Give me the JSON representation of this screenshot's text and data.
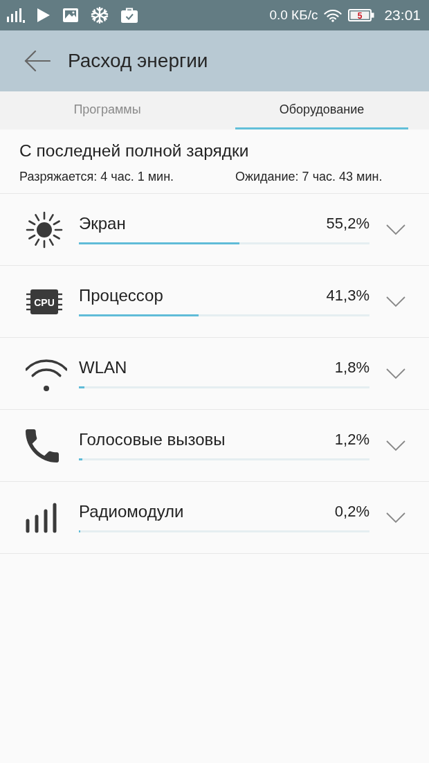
{
  "status_bar": {
    "network_speed": "0.0 КБ/с",
    "battery_text": "5",
    "time": "23:01"
  },
  "header": {
    "title": "Расход энергии"
  },
  "tabs": [
    {
      "label": "Программы",
      "selected": false
    },
    {
      "label": "Оборудование",
      "selected": true
    }
  ],
  "summary": {
    "title": "С последней полной зарядки",
    "discharging": "Разряжается: 4 час. 1 мин.",
    "standby": "Ожидание: 7 час. 43 мин."
  },
  "items": [
    {
      "name": "Экран",
      "percent": "55,2%",
      "level": 0.552,
      "expanded": false
    },
    {
      "name": "Процессор",
      "chip_label": "CPU",
      "percent": "41,3%",
      "level": 0.413,
      "expanded": false
    },
    {
      "name": "WLAN",
      "percent": "1,8%",
      "level": 0.018,
      "expanded": false
    },
    {
      "name": "Голосовые вызовы",
      "percent": "1,2%",
      "level": 0.012,
      "expanded": false
    },
    {
      "name": "Радиомодули",
      "percent": "0,2%",
      "level": 0.002,
      "expanded": false
    }
  ]
}
